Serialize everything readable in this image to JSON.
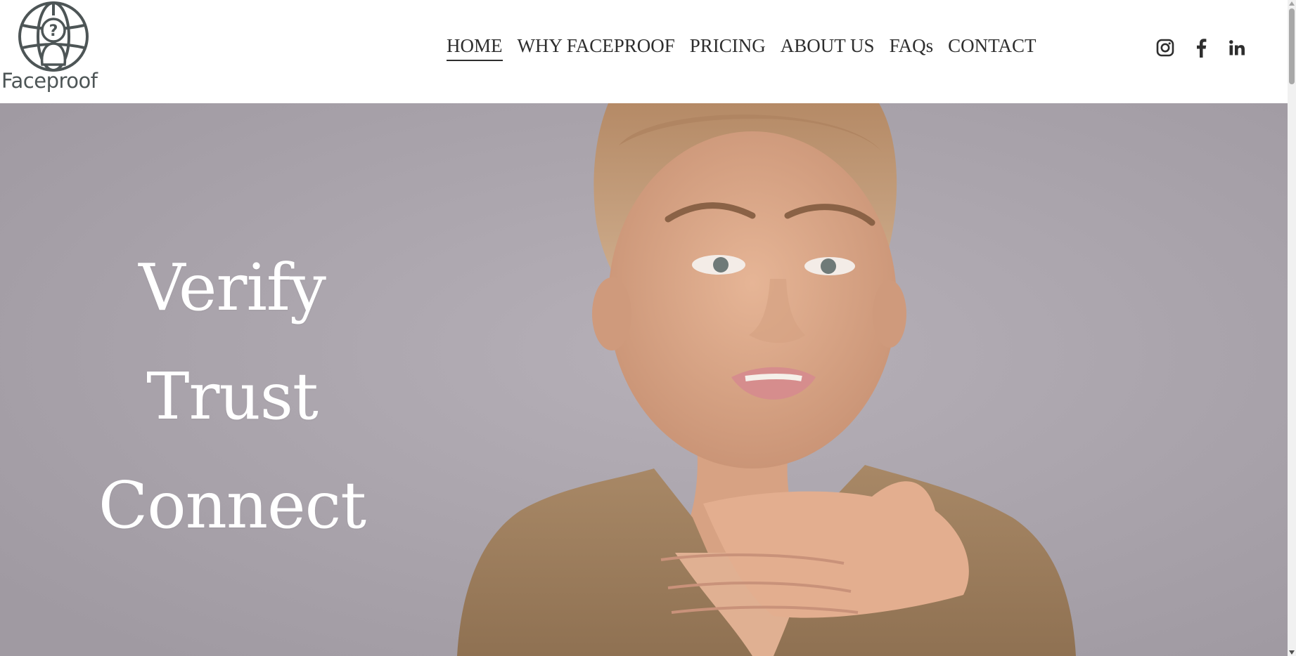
{
  "brand": {
    "name": "Faceproof",
    "logo_icon": "globe-question-face-icon",
    "logo_color": "#4d5556"
  },
  "nav": {
    "items": [
      {
        "label": "HOME",
        "active": true
      },
      {
        "label": "WHY FACEPROOF",
        "active": false
      },
      {
        "label": "PRICING",
        "active": false
      },
      {
        "label": "ABOUT US",
        "active": false
      },
      {
        "label": "FAQs",
        "active": false
      },
      {
        "label": "CONTACT",
        "active": false
      }
    ]
  },
  "social": {
    "icons": [
      "instagram-icon",
      "facebook-icon",
      "linkedin-icon"
    ],
    "color": "#2e2e2e"
  },
  "hero": {
    "words": [
      "Verify",
      "Trust",
      "Connect"
    ],
    "text_color": "#ffffff",
    "background_color": "#aca4ac"
  }
}
